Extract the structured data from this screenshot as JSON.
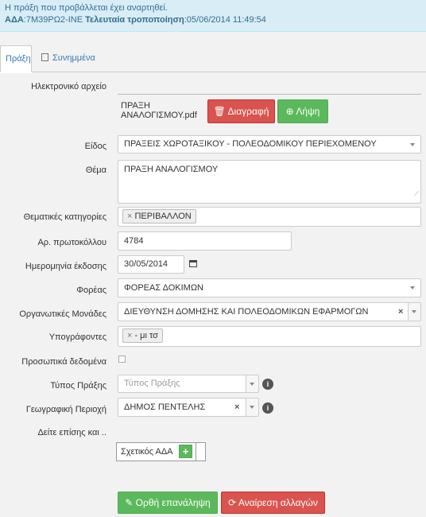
{
  "banner": {
    "message": "Η πράξη που προβάλλεται έχει αναρτηθεί.",
    "ada_label": "ΑΔΑ",
    "ada_value": ":7Μ39ΡΩ2-ΙΝΕ",
    "modified_label": "Τελευταία τροποποίηση",
    "modified_value": ":05/06/2014 11:49:54"
  },
  "tabs": [
    {
      "label": "Πράξη"
    },
    {
      "label": "Συνημμένα"
    }
  ],
  "form": {
    "file_label": "Ηλεκτρονικό αρχείο",
    "file_name_line1": "ΠΡΑΞΗ",
    "file_name_line2": "ΑΝΑΛΟΓΙΣΜΟΥ.pdf",
    "delete_label": "Διαγραφή",
    "download_label": "Λήψη",
    "type_label": "Είδος",
    "type_value": "ΠΡΑΞΕΙΣ ΧΩΡΟΤΑΞΙΚΟΥ - ΠΟΛΕΟΔΟΜΙΚΟΥ ΠΕΡΙΕΧΟΜΕΝΟΥ",
    "subject_label": "Θέμα",
    "subject_value": "ΠΡΑΞΗ ΑΝΑΛΟΓΙΣΜΟΥ",
    "categories_label": "Θεματικές κατηγορίες",
    "category_tag": "ΠΕΡΙΒΑΛΛΟΝ",
    "protocol_label": "Αρ. πρωτοκόλλου",
    "protocol_value": "4784",
    "date_label": "Ημερομηνία έκδοσης",
    "date_value": "30/05/2014",
    "agency_label": "Φορέας",
    "agency_value": "ΦΟΡΕΑΣ ΔΟΚΙΜΩΝ",
    "units_label": "Οργανωτικές Μονάδες",
    "units_value": "ΔΙΕΥΘΥΝΣΗ ΔΟΜΗΣΗΣ ΚΑΙ ΠΟΛΕΟΔΟΜΙΚΩΝ ΕΦΑΡΜΟΓΩΝ",
    "signers_label": "Υπογράφοντες",
    "signer_tag": "- μι τσ",
    "personal_label": "Προσωπικά δεδομένα",
    "act_type_label": "Τύπος Πράξης",
    "act_type_placeholder": "Τύπος Πράξης",
    "geo_label": "Γεωγραφική Περιοχή",
    "geo_value": "ΔΗΜΟΣ ΠΕΝΤΕΛΗΣ",
    "see_also_label": "Δείτε επίσης και ..",
    "related_ada_label": "Σχετικός ΑΔΑ"
  },
  "actions": {
    "correct_label": "Ορθή επανάληψη",
    "revert_label": "Αναίρεση αλλαγών"
  }
}
